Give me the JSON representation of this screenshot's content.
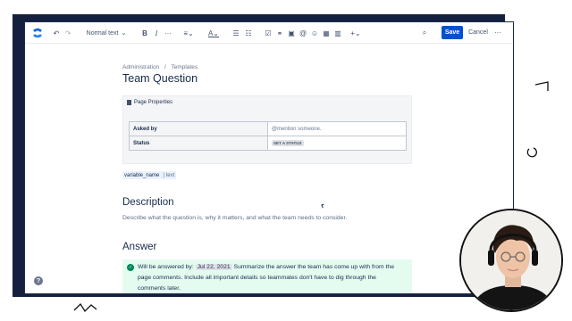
{
  "toolbar": {
    "text_style": "Normal text",
    "save_label": "Save",
    "cancel_label": "Cancel",
    "more_label": "···"
  },
  "breadcrumb": [
    "Administration",
    "/",
    "Templates"
  ],
  "page_title": "Team Question",
  "page_properties": {
    "title": "Page Properties",
    "rows": [
      {
        "key": "Asked by",
        "value": "@mention someone."
      },
      {
        "key": "Status",
        "value": "SET A STATUS"
      }
    ]
  },
  "variable": {
    "name": "variable_name",
    "type": "| text"
  },
  "description": {
    "heading": "Description",
    "text": "Describe what the question is, why it matters, and what the team needs to consider."
  },
  "answer": {
    "heading": "Answer",
    "prefix": "Will be answered by:",
    "date": "Jul 22, 2021",
    "text": "Summarize the answer the team has come up with from the page comments. Include all important details so teammates don't have to dig through the comments later."
  },
  "help_label": "?",
  "colors": {
    "accent": "#0052cc",
    "panel": "#e3fcef",
    "backdrop": "#13213f",
    "success": "#00875a"
  }
}
